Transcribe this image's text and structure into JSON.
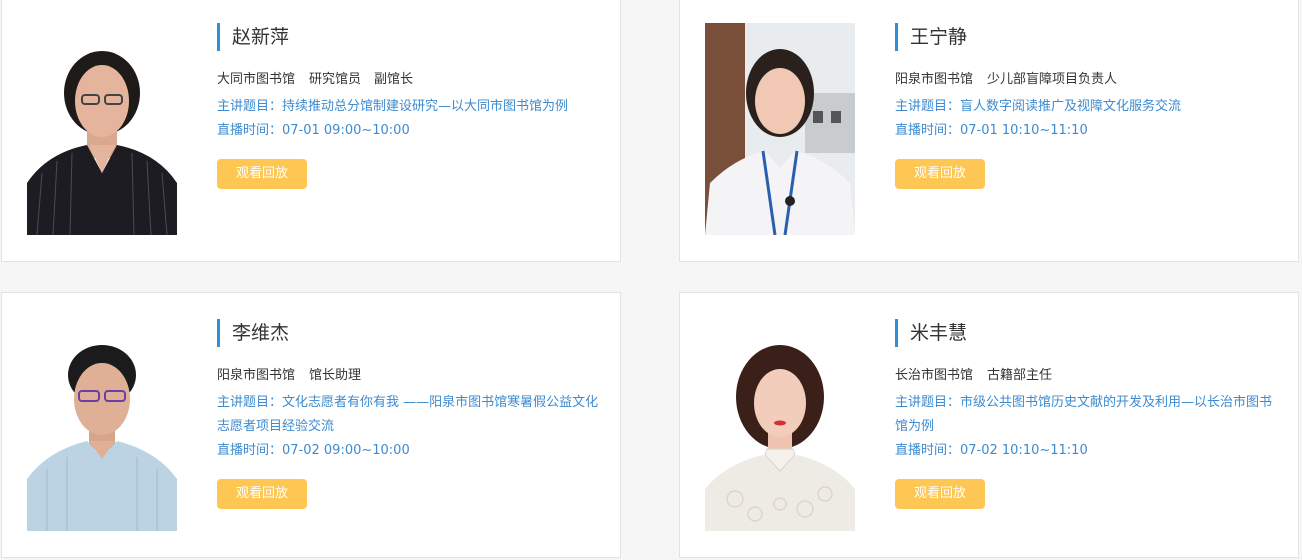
{
  "speakers": [
    {
      "name": "赵新萍",
      "org": "大同市图书馆",
      "title": "研究馆员　副馆长",
      "topic": "主讲题目：持续推动总分馆制建设研究—以大同市图书馆为例",
      "time": "直播时间：07-01 09:00~10:00",
      "button": "观看回放"
    },
    {
      "name": "王宁静",
      "org": "阳泉市图书馆",
      "title": "少儿部盲障项目负责人",
      "topic": "主讲题目：盲人数字阅读推广及视障文化服务交流",
      "time": "直播时间：07-01 10:10~11:10",
      "button": "观看回放"
    },
    {
      "name": "李维杰",
      "org": "阳泉市图书馆",
      "title": "馆长助理",
      "topic": "主讲题目：文化志愿者有你有我 ——阳泉市图书馆寒暑假公益文化志愿者项目经验交流",
      "time": "直播时间：07-02 09:00~10:00",
      "button": "观看回放"
    },
    {
      "name": "米丰慧",
      "org": "长治市图书馆",
      "title": "古籍部主任",
      "topic": "主讲题目：市级公共图书馆历史文献的开发及利用—以长治市图书馆为例",
      "time": "直播时间：07-02 10:10~11:10",
      "button": "观看回放"
    }
  ],
  "colors": {
    "accent_bar": "#2f8fd8",
    "topic_text": "#3d8bd0",
    "button_bg": "#fec652"
  }
}
